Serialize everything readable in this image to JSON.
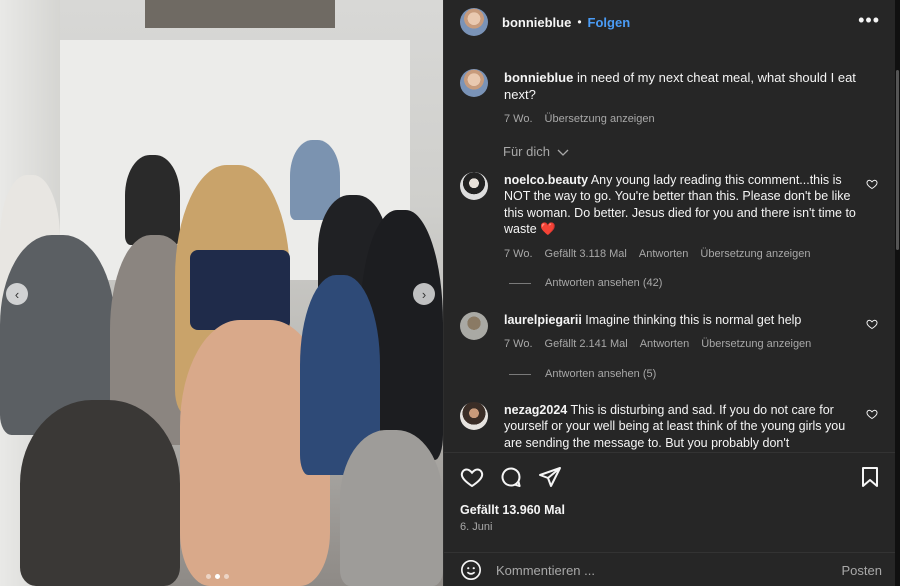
{
  "post": {
    "username": "bonnieblue",
    "follow_label": "Folgen",
    "separator": "•",
    "more_label": "•••"
  },
  "carousel": {
    "prev_icon": "‹",
    "next_icon": "›",
    "slide_count": 3,
    "active_slide": 2
  },
  "caption": {
    "username": "bonnieblue",
    "text": "in need of my next cheat meal, what should I eat next?",
    "age": "7 Wo.",
    "translate": "Übersetzung anzeigen"
  },
  "sort": {
    "label": "Für dich"
  },
  "comments": [
    {
      "username": "noelco.beauty",
      "text": "Any young lady reading this comment...this is NOT the way to go. You're better than this. Please don't be like this woman. Do better. Jesus died for you and there isn't time to waste",
      "emoji": "❤️",
      "age": "7 Wo.",
      "likes": "Gefällt 3.118 Mal",
      "reply": "Antworten",
      "translate": "Übersetzung anzeigen",
      "view_replies": "Antworten ansehen (42)"
    },
    {
      "username": "laurelpiegarii",
      "text": "Imagine thinking this is normal get help",
      "age": "7 Wo.",
      "likes": "Gefällt 2.141 Mal",
      "reply": "Antworten",
      "translate": "Übersetzung anzeigen",
      "view_replies": "Antworten ansehen (5)"
    },
    {
      "username": "nezag2024",
      "text": "This is disturbing and sad. If you do not care for yourself or your well being at least think of the young girls you are sending the message to. But you probably don't"
    }
  ],
  "footer": {
    "likes": "Gefällt 13.960 Mal",
    "date": "6. Juni",
    "comment_placeholder": "Kommentieren ...",
    "post_label": "Posten"
  },
  "colors": {
    "panel_bg": "#262626",
    "link_blue": "#4a9cf6",
    "muted": "#a8a8a8"
  }
}
